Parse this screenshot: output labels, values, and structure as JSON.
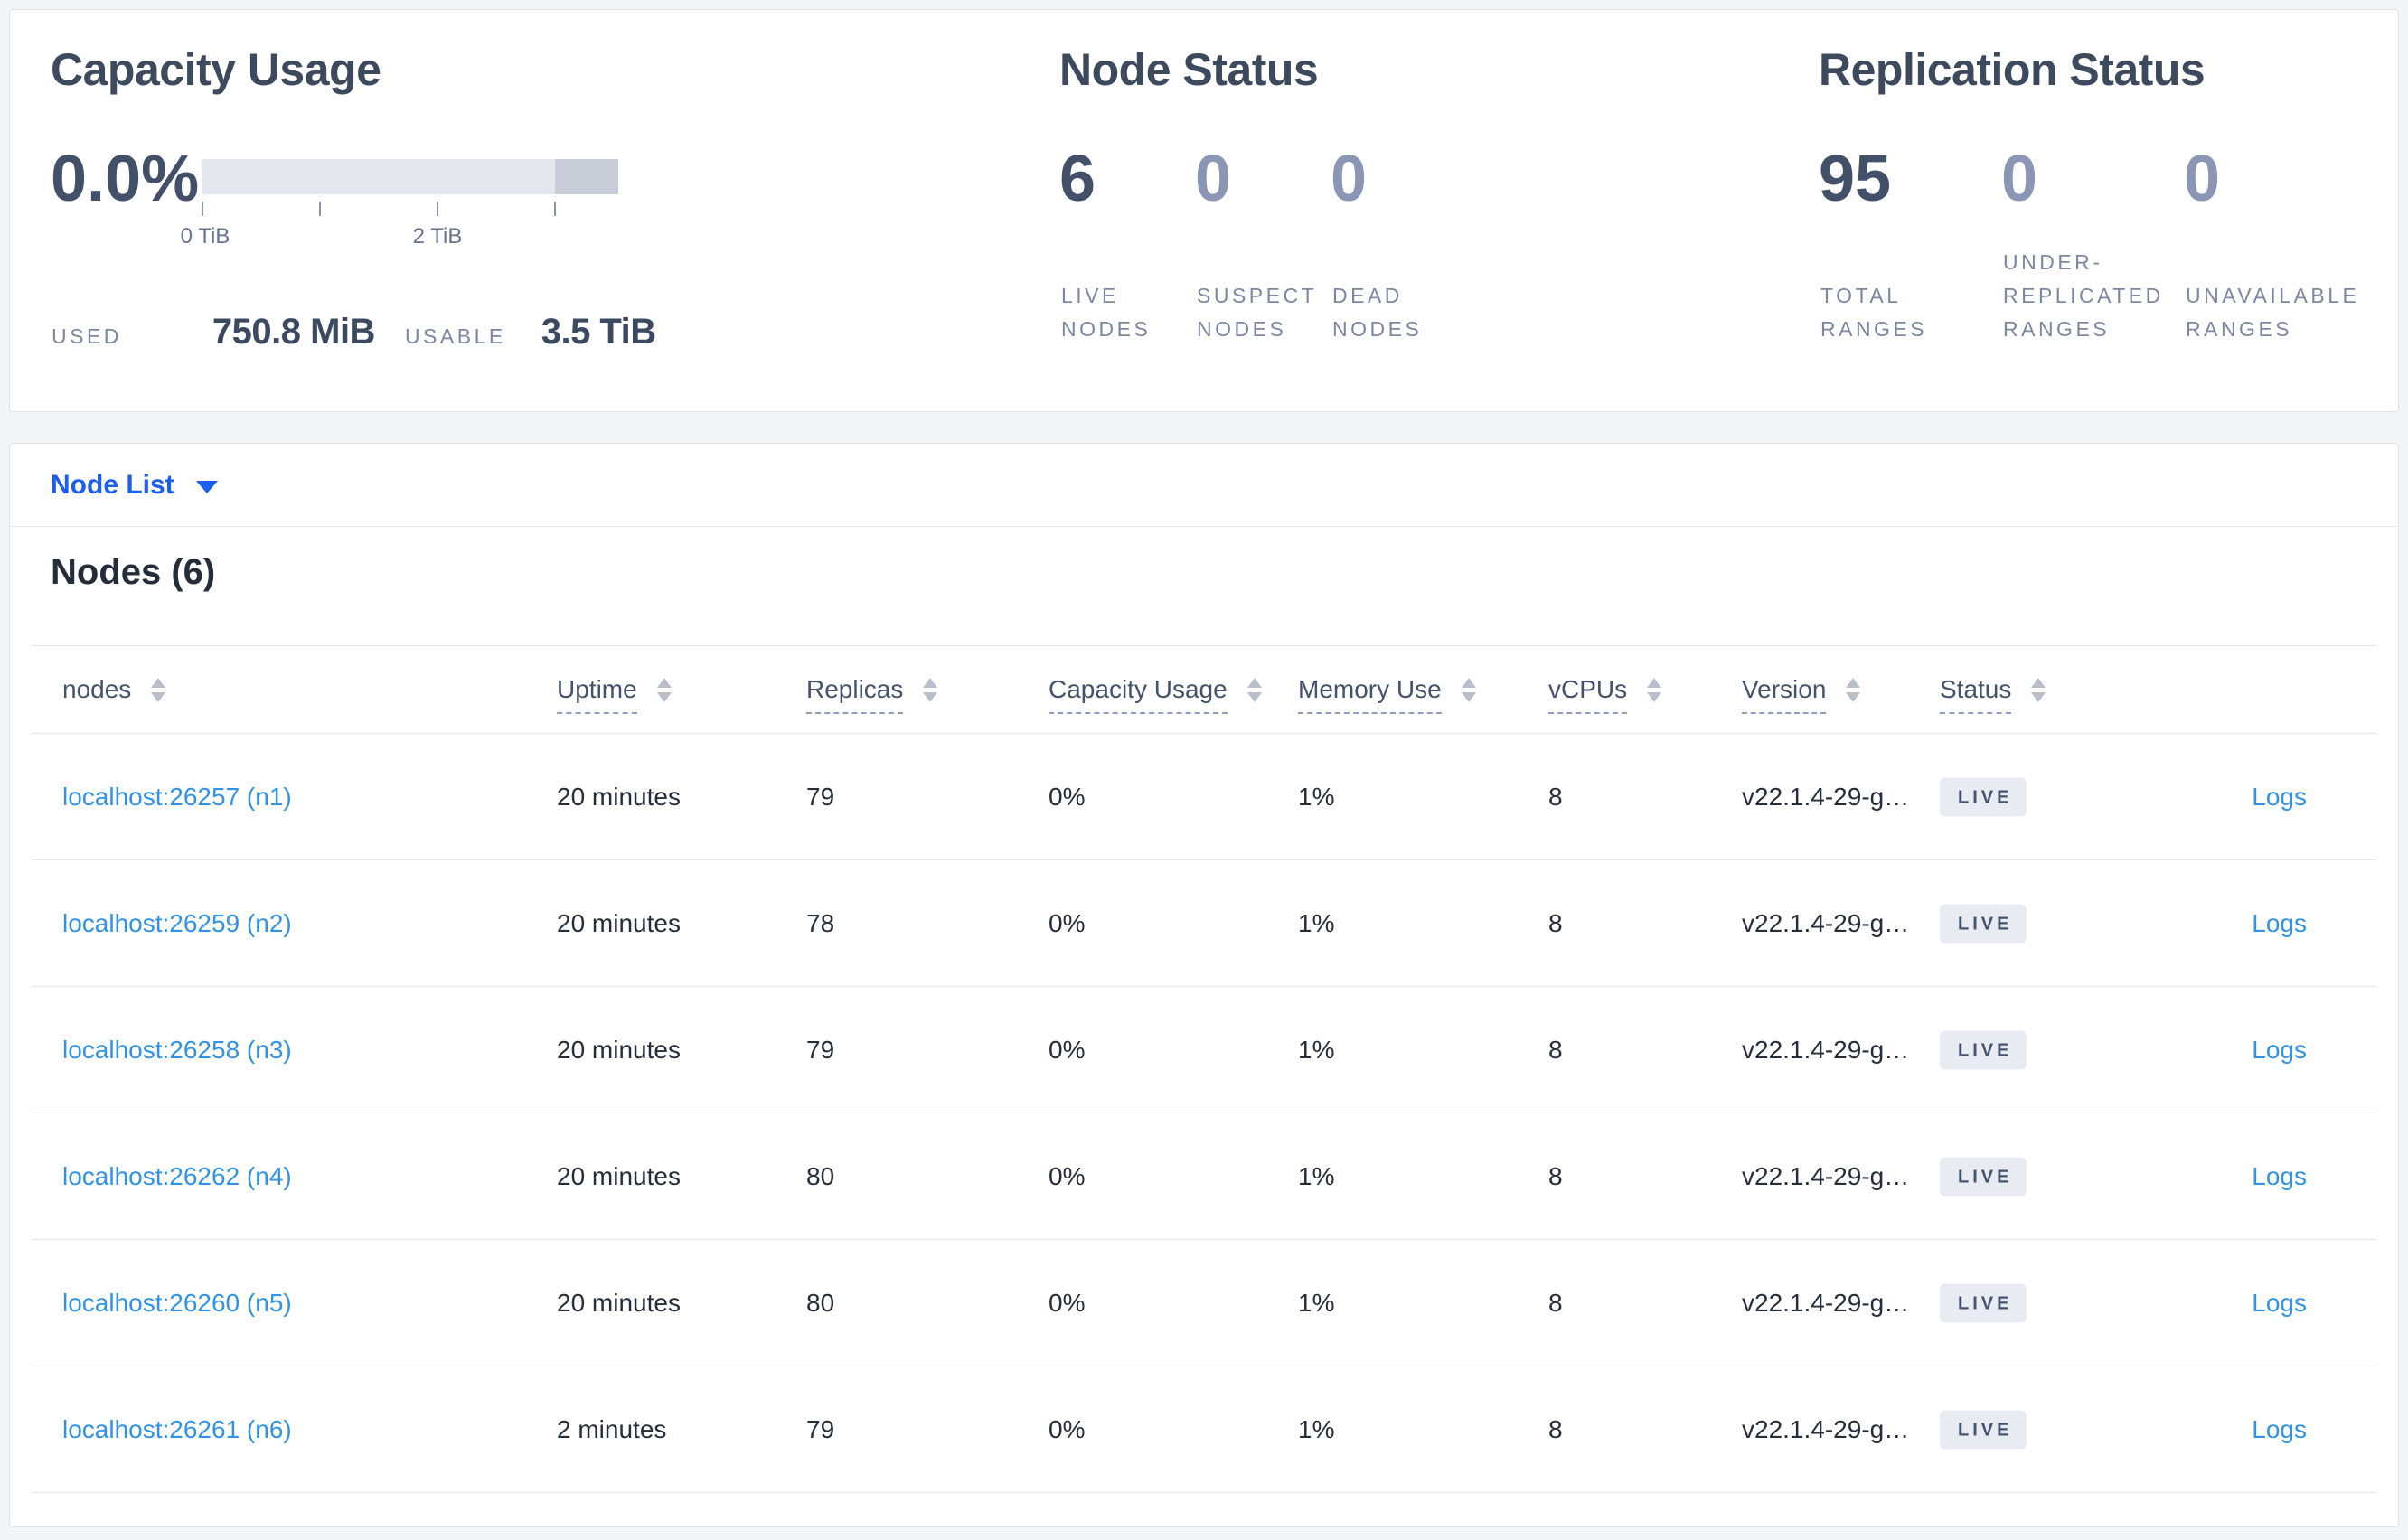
{
  "summary": {
    "capacity": {
      "title": "Capacity Usage",
      "percent": "0.0%",
      "tick_labels": [
        "0 TiB",
        "2 TiB"
      ],
      "used_label": "USED",
      "used_value": "750.8 MiB",
      "usable_label": "USABLE",
      "usable_value": "3.5 TiB"
    },
    "node_status": {
      "title": "Node Status",
      "metrics": [
        {
          "value": "6",
          "label": "LIVE NODES"
        },
        {
          "value": "0",
          "label": "SUSPECT NODES"
        },
        {
          "value": "0",
          "label": "DEAD NODES"
        }
      ]
    },
    "replication": {
      "title": "Replication Status",
      "metrics": [
        {
          "value": "95",
          "label": "TOTAL RANGES"
        },
        {
          "value": "0",
          "label": "UNDER-REPLICATED RANGES"
        },
        {
          "value": "0",
          "label": "UNAVAILABLE RANGES"
        }
      ]
    }
  },
  "node_list": {
    "dropdown_label": "Node List"
  },
  "nodes_section": {
    "title": "Nodes (6)"
  },
  "table": {
    "columns": {
      "nodes": "nodes",
      "uptime": "Uptime",
      "replicas": "Replicas",
      "capacity": "Capacity Usage",
      "memory": "Memory Use",
      "vcpus": "vCPUs",
      "version": "Version",
      "status": "Status"
    },
    "rows": [
      {
        "node": "localhost:26257 (n1)",
        "uptime": "20 minutes",
        "replicas": "79",
        "capacity": "0%",
        "memory": "1%",
        "vcpus": "8",
        "version": "v22.1.4-29-g…",
        "status": "LIVE",
        "logs": "Logs"
      },
      {
        "node": "localhost:26259 (n2)",
        "uptime": "20 minutes",
        "replicas": "78",
        "capacity": "0%",
        "memory": "1%",
        "vcpus": "8",
        "version": "v22.1.4-29-g…",
        "status": "LIVE",
        "logs": "Logs"
      },
      {
        "node": "localhost:26258 (n3)",
        "uptime": "20 minutes",
        "replicas": "79",
        "capacity": "0%",
        "memory": "1%",
        "vcpus": "8",
        "version": "v22.1.4-29-g…",
        "status": "LIVE",
        "logs": "Logs"
      },
      {
        "node": "localhost:26262 (n4)",
        "uptime": "20 minutes",
        "replicas": "80",
        "capacity": "0%",
        "memory": "1%",
        "vcpus": "8",
        "version": "v22.1.4-29-g…",
        "status": "LIVE",
        "logs": "Logs"
      },
      {
        "node": "localhost:26260 (n5)",
        "uptime": "20 minutes",
        "replicas": "80",
        "capacity": "0%",
        "memory": "1%",
        "vcpus": "8",
        "version": "v22.1.4-29-g…",
        "status": "LIVE",
        "logs": "Logs"
      },
      {
        "node": "localhost:26261 (n6)",
        "uptime": "2 minutes",
        "replicas": "79",
        "capacity": "0%",
        "memory": "1%",
        "vcpus": "8",
        "version": "v22.1.4-29-g…",
        "status": "LIVE",
        "logs": "Logs"
      }
    ]
  },
  "colors": {
    "page_background": "#f4f5f9",
    "panel_border": "#e0e3e9",
    "primary_link_blue": "#1c5ef0",
    "table_link_blue": "#3093e8",
    "heading_slate": "#3d4a5e",
    "metric_dark": "#42506a",
    "metric_dim": "#8b96b4",
    "badge_background": "#e8ecf2",
    "badge_text": "#44536e",
    "bar_light": "#e5e7ec",
    "bar_dark": "#c9cdd7"
  }
}
